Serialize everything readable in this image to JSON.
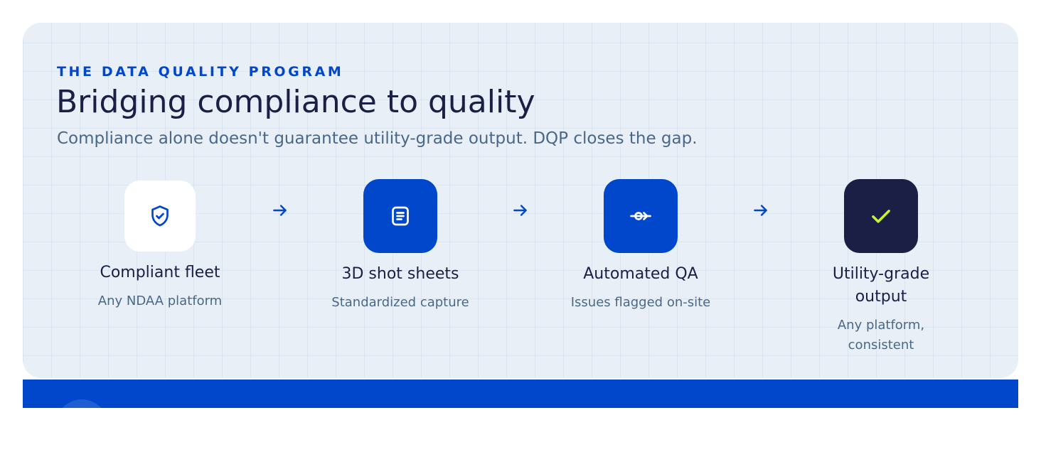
{
  "section": {
    "eyebrow": "THE DATA QUALITY PROGRAM",
    "title": "Bridging compliance to quality",
    "subtitle": "Compliance alone doesn't guarantee utility-grade output. DQP closes the gap."
  },
  "steps": [
    {
      "icon": "shield-check-icon",
      "title": "Compliant fleet",
      "subtitle": "Any NDAA platform"
    },
    {
      "icon": "document-icon",
      "title": "3D shot sheets",
      "subtitle": "Standardized capture"
    },
    {
      "icon": "commit-arrow-icon",
      "title": "Automated QA",
      "subtitle": "Issues flagged on-site"
    },
    {
      "icon": "check-icon",
      "title": "Utility-grade output",
      "subtitle": "Any platform, consistent"
    }
  ],
  "arrow_icon": "arrow-right-icon",
  "colors": {
    "brand_blue": "#0047cc",
    "navy": "#1b1f45",
    "card_bg": "#e8eff7",
    "muted_text": "#4a6886",
    "accent_lime": "#c6f432"
  }
}
